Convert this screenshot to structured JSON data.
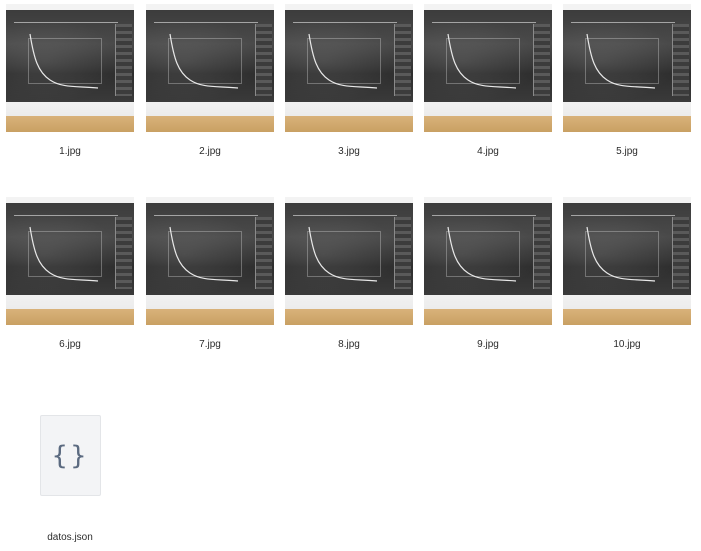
{
  "files": [
    {
      "name": "1.jpg"
    },
    {
      "name": "2.jpg"
    },
    {
      "name": "3.jpg"
    },
    {
      "name": "4.jpg"
    },
    {
      "name": "5.jpg"
    },
    {
      "name": "6.jpg"
    },
    {
      "name": "7.jpg"
    },
    {
      "name": "8.jpg"
    },
    {
      "name": "9.jpg"
    },
    {
      "name": "10.jpg"
    }
  ],
  "json_file": {
    "name": "datos.json",
    "icon": "curly-braces-icon",
    "glyph": "{}"
  },
  "colors": {
    "background": "#ffffff",
    "label_text": "#2b2b2b",
    "json_icon": "#5b6a80",
    "json_tile": "#f3f4f6"
  }
}
